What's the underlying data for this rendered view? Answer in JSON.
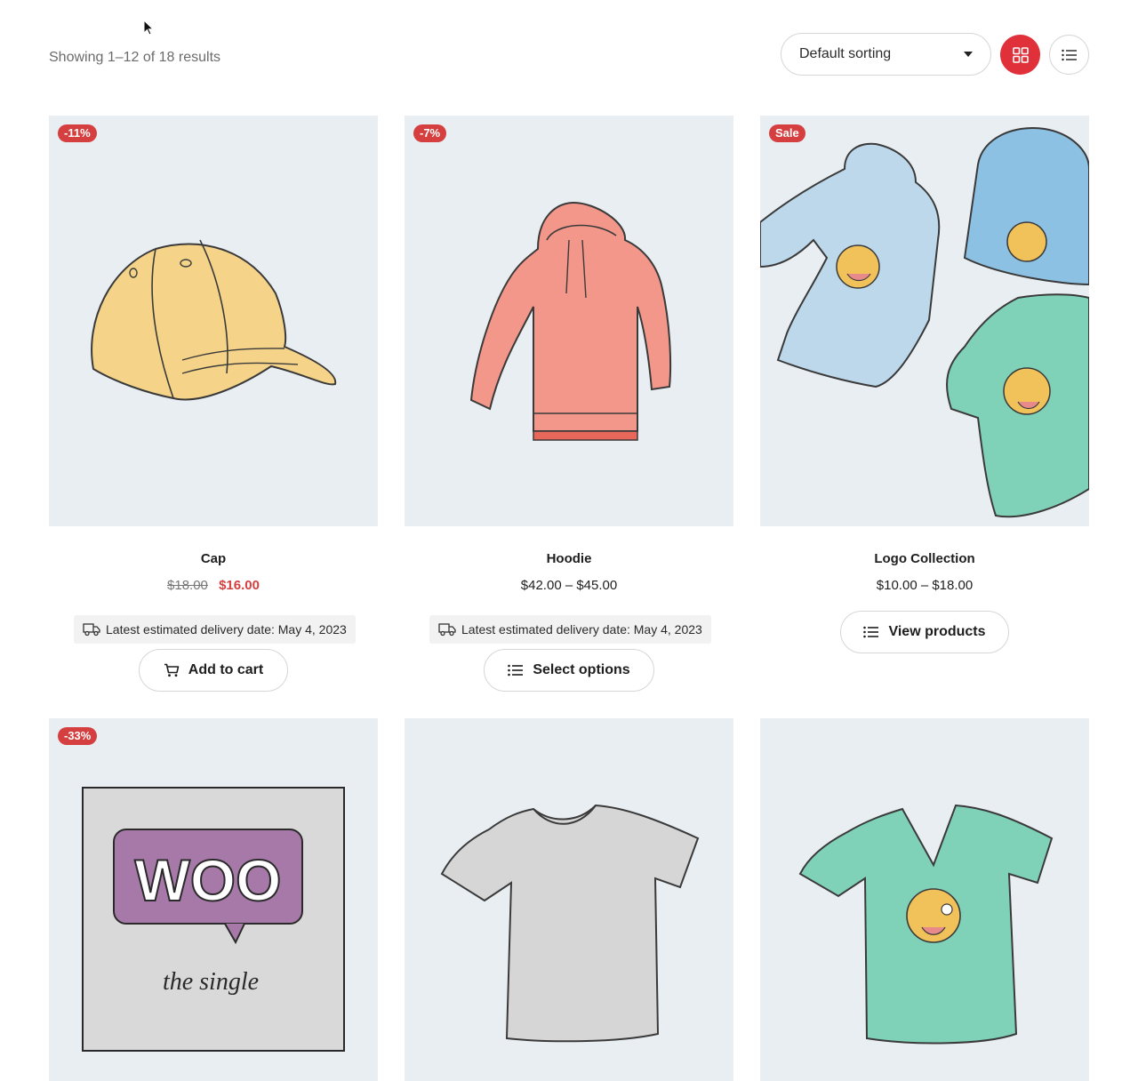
{
  "toolbar": {
    "result_count": "Showing 1–12 of 18 results",
    "sorting_selected": "Default sorting",
    "grid_view_icon": "grid-icon",
    "list_view_icon": "list-icon",
    "accent_color": "#e0303a"
  },
  "products": [
    {
      "badge": "-11%",
      "name": "Cap",
      "price_old": "$18.00",
      "price_new": "$16.00",
      "delivery": "Latest estimated delivery date: May 4, 2023",
      "button": "Add to cart",
      "button_icon": "cart-icon"
    },
    {
      "badge": "-7%",
      "name": "Hoodie",
      "price": "$42.00 – $45.00",
      "delivery": "Latest estimated delivery date: May 4, 2023",
      "button": "Select options",
      "button_icon": "list-icon"
    },
    {
      "badge": "Sale",
      "name": "Logo Collection",
      "price": "$10.00 – $18.00",
      "button": "View products",
      "button_icon": "list-icon"
    },
    {
      "badge": "-33%",
      "image_text_1": "WOO",
      "image_text_2": "the   single"
    },
    {},
    {}
  ],
  "colors": {
    "badge": "#d53f3f",
    "thumb_bg": "#e9eef2",
    "sale_price": "#d53f3f"
  }
}
